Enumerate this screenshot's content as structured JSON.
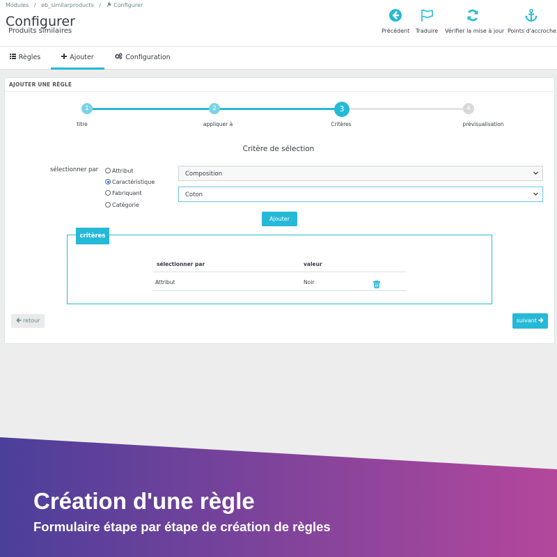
{
  "breadcrumb": [
    "Modules",
    "/",
    "eb_similarproducts",
    "/",
    "Configurer"
  ],
  "header": {
    "title": "Configurer",
    "subtitle": "Produits similaires",
    "toolbar": {
      "back": "Précédent",
      "translate": "Traduire",
      "update": "Vérifier la mise à jour",
      "hooks": "Points d'accroche"
    }
  },
  "tabs": [
    "Règles",
    "Ajouter",
    "Configuration"
  ],
  "active_tab": "Ajouter",
  "panel": {
    "heading": "AJOUTER UNE RÈGLE",
    "steps": [
      {
        "number": "1",
        "label": "titre"
      },
      {
        "number": "2",
        "label": "appliquer à"
      },
      {
        "number": "3",
        "label": "Critères"
      },
      {
        "number": "4",
        "label": "prévisualisation"
      }
    ],
    "current_step": 3,
    "section_title": "Critère de sélection",
    "select_by_label": "sélectionner par",
    "radio_options": [
      "Attribut",
      "Caractéristique",
      "Fabriquant",
      "Catégorie"
    ],
    "selected_radio": "Caractéristique",
    "select_feature_value": "Composition",
    "select_value_value": "Coton",
    "add_button": "Ajouter",
    "criteria": {
      "legend": "critères",
      "columns": [
        "sélectionner par",
        "valeur"
      ],
      "rows": [
        {
          "select_by": "Attribut",
          "value": "Noir"
        }
      ]
    },
    "back_button": "retour",
    "next_button": "suivant"
  },
  "banner": {
    "title": "Création d'une règle",
    "subtitle": "Formulaire étape par étape de création de règles",
    "gradient_start": "#4b3f9a",
    "gradient_end": "#b4479c"
  },
  "colors": {
    "accent": "#25b9d7",
    "step_inactive": "#d8d8d8"
  }
}
